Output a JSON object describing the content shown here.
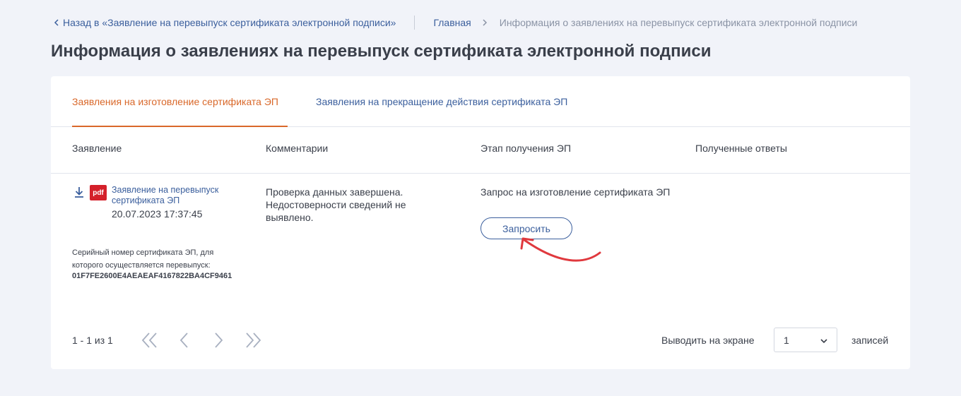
{
  "breadcrumbs": {
    "back_label": "Назад в «Заявление на перевыпуск сертификата электронной подписи»",
    "home": "Главная",
    "current": "Информация о заявлениях на перевыпуск сертификата электронной подписи"
  },
  "page_title": "Информация о заявлениях на перевыпуск сертификата электронной подписи",
  "tabs": [
    {
      "label": "Заявления на изготовление сертификата ЭП",
      "active": true
    },
    {
      "label": "Заявления на прекращение действия сертификата ЭП",
      "active": false
    }
  ],
  "table": {
    "columns": [
      "Заявление",
      "Комментарии",
      "Этап получения ЭП",
      "Полученные ответы"
    ],
    "rows": [
      {
        "file_type": "pdf",
        "doc_title": "Заявление на перевыпуск сертификата ЭП",
        "date": "20.07.2023 17:37:45",
        "serial_label": "Серийный номер сертификата ЭП, для которого осуществляется перевыпуск:",
        "serial_value": "01F7FE2600E4AEAEAF4167822BA4CF9461",
        "comment": "Проверка данных завершена. Недостоверности сведений не выявлено.",
        "stage": "Запрос на изготовление сертификата ЭП",
        "action_label": "Запросить",
        "answers": ""
      }
    ]
  },
  "pagination": {
    "info": "1 - 1 из 1",
    "per_page_label": "Выводить на экране",
    "per_page_value": "1",
    "per_page_suffix": "записей"
  },
  "colors": {
    "accent": "#d9682a",
    "link": "#3b5f9d",
    "annotation_arrow": "#e0393e",
    "pdf_badge": "#d4202a"
  },
  "icons": [
    "chevron-left-icon",
    "chevron-right-icon",
    "download-icon",
    "pdf-icon",
    "first-page-icon",
    "prev-page-icon",
    "next-page-icon",
    "last-page-icon",
    "chevron-down-icon"
  ]
}
